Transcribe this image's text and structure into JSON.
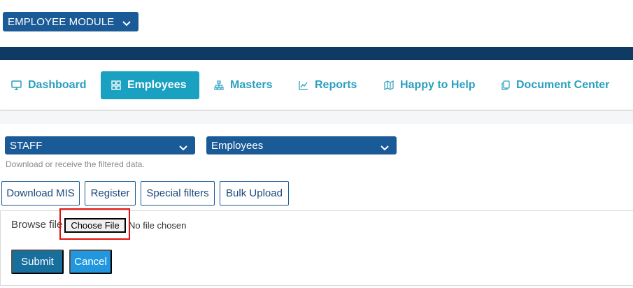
{
  "module_selector": {
    "value": "EMPLOYEE MODULE",
    "icon": "chevron-down-icon"
  },
  "nav": {
    "items": [
      {
        "label": "Dashboard",
        "icon": "monitor-icon",
        "active": false
      },
      {
        "label": "Employees",
        "icon": "grid-icon",
        "active": true
      },
      {
        "label": "Masters",
        "icon": "hierarchy-icon",
        "active": false
      },
      {
        "label": "Reports",
        "icon": "chart-line-icon",
        "active": false
      },
      {
        "label": "Happy to Help",
        "icon": "map-icon",
        "active": false
      },
      {
        "label": "Document Center",
        "icon": "copy-icon",
        "active": false
      }
    ]
  },
  "filters": {
    "category": "STAFF",
    "type": "Employees",
    "hint": "Download or receive the filtered data."
  },
  "actions": {
    "download_mis": "Download MIS",
    "register": "Register",
    "special_filters": "Special filters",
    "bulk_upload": "Bulk Upload"
  },
  "upload": {
    "browse_label": "Browse file",
    "choose_file": "Choose File",
    "no_file": "No file chosen",
    "submit": "Submit",
    "cancel": "Cancel"
  },
  "colors": {
    "primary": "#1a5a96",
    "header_bar": "#0f3a63",
    "active_tab": "#1aa1c1",
    "nav_text": "#2a9fc0",
    "submit": "#176f9e",
    "cancel": "#2197e0",
    "highlight": "#e01010"
  }
}
